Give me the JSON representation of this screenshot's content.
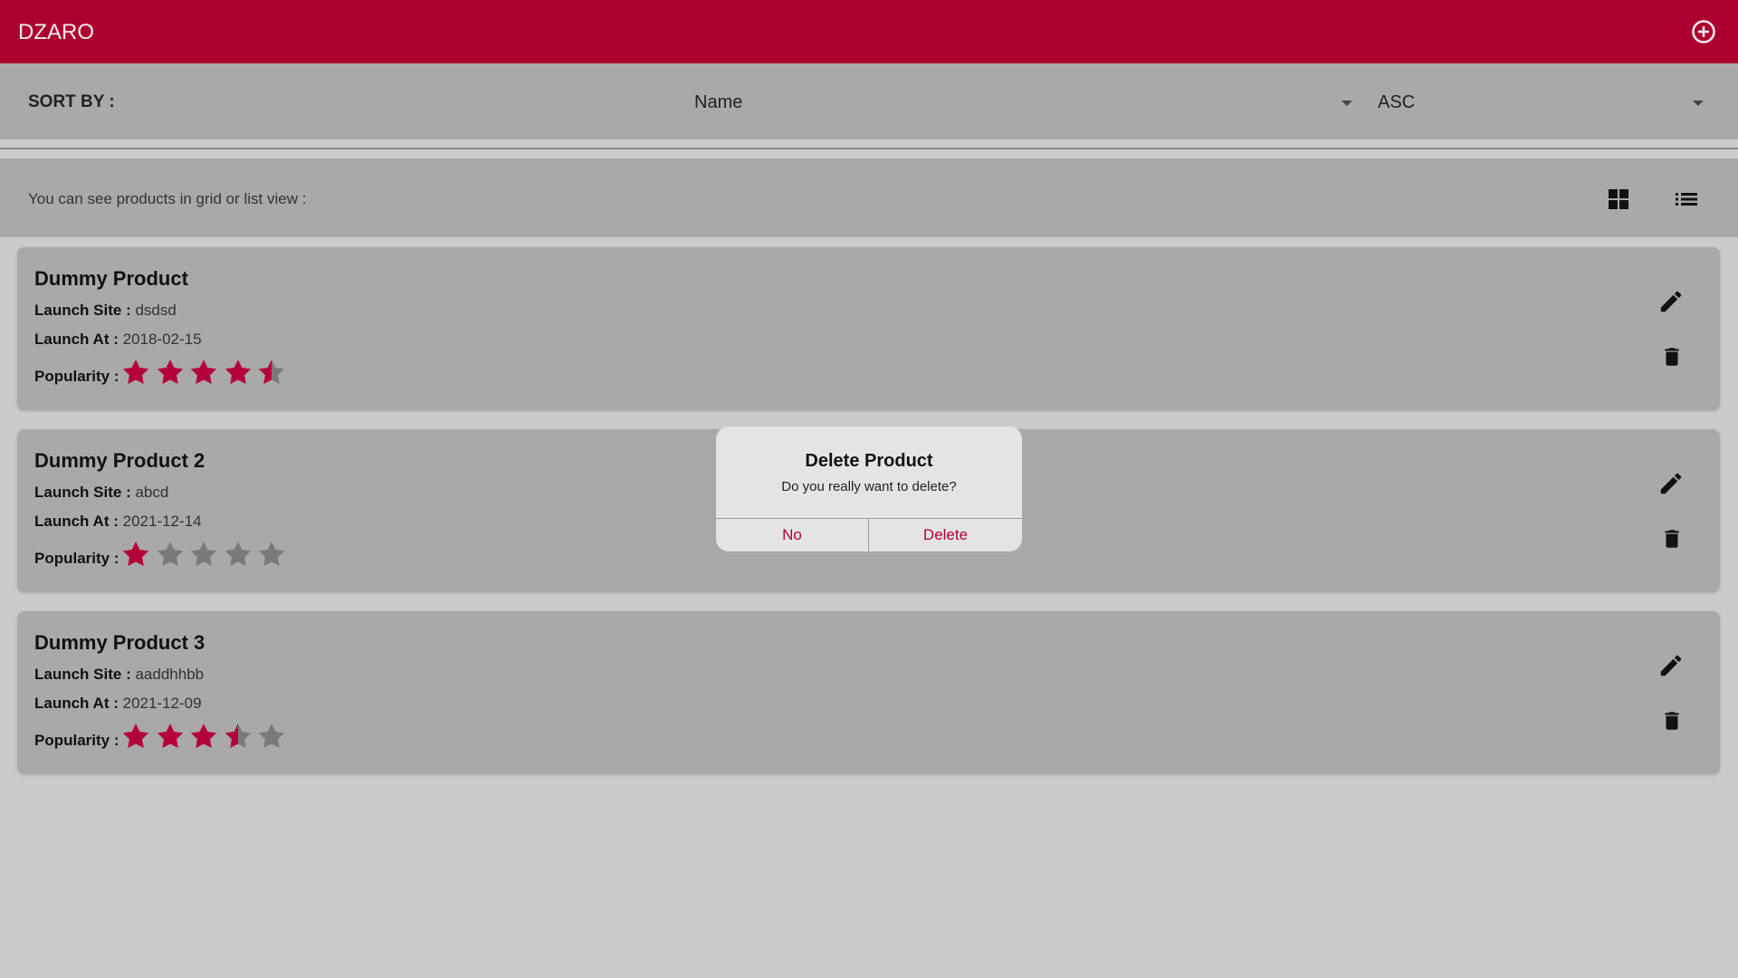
{
  "app": {
    "brand": "DZARO",
    "add_icon": "add-circle-icon"
  },
  "sort": {
    "label": "SORT BY :",
    "field_value": "Name",
    "order_value": "ASC"
  },
  "view": {
    "text": "You can see products in grid or list view :",
    "grid_icon": "grid-view-icon",
    "list_icon": "list-view-icon"
  },
  "labels": {
    "launch_site": "Launch Site :",
    "launch_at": "Launch At :",
    "popularity": "Popularity :"
  },
  "products": [
    {
      "name": "Dummy Product",
      "launch_site": "dsdsd",
      "launch_at": "2018-02-15",
      "popularity": 4.5,
      "max_popularity": 5
    },
    {
      "name": "Dummy Product 2",
      "launch_site": "abcd",
      "launch_at": "2021-12-14",
      "popularity": 1,
      "max_popularity": 5
    },
    {
      "name": "Dummy Product 3",
      "launch_site": "aaddhhbb",
      "launch_at": "2021-12-09",
      "popularity": 3.5,
      "max_popularity": 5
    }
  ],
  "dialog": {
    "title": "Delete Product",
    "message": "Do you really want to delete?",
    "no_label": "No",
    "delete_label": "Delete"
  },
  "colors": {
    "primary": "#ac0030",
    "star_filled": "#b4003a",
    "star_empty": "#7a7a7a",
    "surface": "#a9a9a9",
    "background": "#cbcbcb"
  }
}
